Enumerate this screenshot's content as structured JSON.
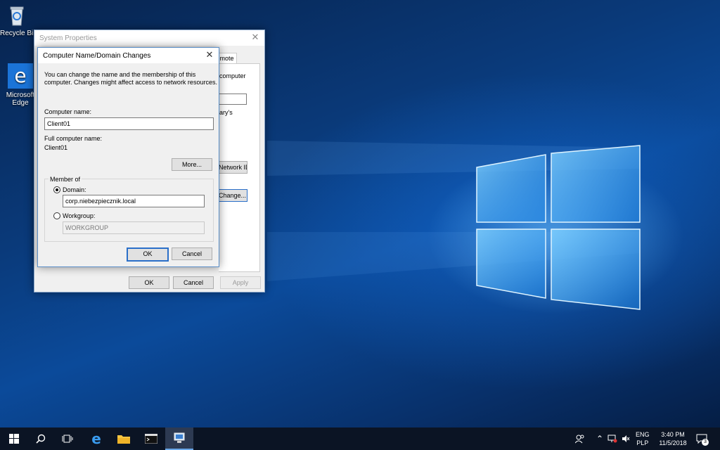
{
  "desktop": {
    "icons": [
      {
        "label": "Recycle Bin"
      },
      {
        "label": "Microsoft Edge"
      }
    ]
  },
  "system_properties": {
    "title": "System Properties",
    "tab_remote": "Remote",
    "partial_text_computer": "computer",
    "partial_text_arys": "ary's",
    "network_id_label": "Network ID...",
    "change_label": "Change...",
    "ok_label": "OK",
    "cancel_label": "Cancel",
    "apply_label": "Apply"
  },
  "dialog": {
    "title": "Computer Name/Domain Changes",
    "description_line1": "You can change the name and the membership of this",
    "description_line2": "computer. Changes might affect access to network resources.",
    "computer_name_label": "Computer name:",
    "computer_name_value": "Client01",
    "full_name_label": "Full computer name:",
    "full_name_value": "Client01",
    "more_label": "More...",
    "member_of_label": "Member of",
    "domain_label": "Domain:",
    "domain_value": "corp.niebezpiecznik.local",
    "workgroup_label": "Workgroup:",
    "workgroup_value": "WORKGROUP",
    "ok_label": "OK",
    "cancel_label": "Cancel",
    "selected_membership": "domain"
  },
  "taskbar": {
    "items": [
      "start-icon",
      "search-icon",
      "task-view-icon",
      "edge-icon",
      "file-explorer-icon",
      "command-prompt-icon",
      "system-properties-icon"
    ],
    "language_top": "ENG",
    "language_bottom": "PLP",
    "time": "3:40 PM",
    "date": "11/5/2018",
    "notification_count": "3"
  },
  "colors": {
    "accent": "#2a6fc9",
    "taskbar": "#0b1424",
    "wallpaper": "#0a3a7a"
  }
}
